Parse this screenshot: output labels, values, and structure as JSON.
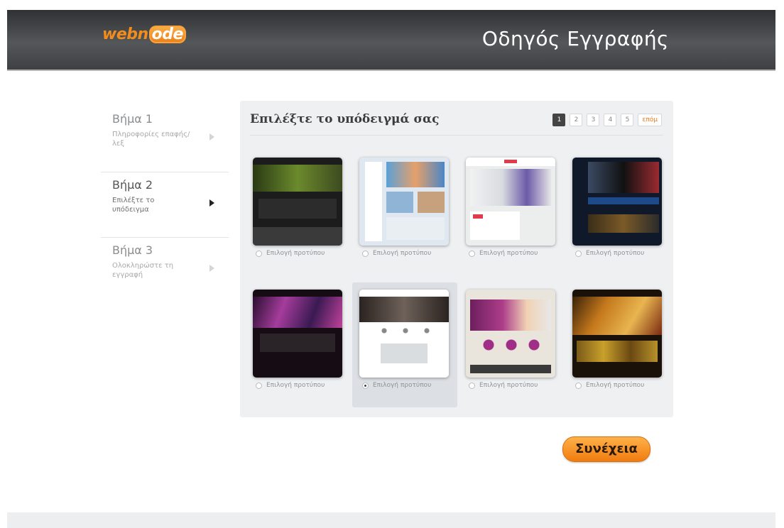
{
  "header": {
    "logo_text_pre": "webn",
    "logo_text_bubble": "ode",
    "title": "Οδηγός Εγγραφής"
  },
  "steps": [
    {
      "title": "Βήμα 1",
      "description": "Πληροφορίες επαφής/λεξ",
      "active": false
    },
    {
      "title": "Βήμα 2",
      "description": "Επιλέξτε το υπόδειγμα",
      "active": true
    },
    {
      "title": "Βήμα 3",
      "description": "Ολοκληρώστε τη εγγραφή",
      "active": false
    }
  ],
  "panel": {
    "title": "Επιλέξτε το υπόδειγμά σας",
    "pagination": {
      "pages": [
        "1",
        "2",
        "3",
        "4",
        "5"
      ],
      "current": "1",
      "next_label": "επόμ"
    }
  },
  "templates": [
    {
      "label": "Επιλογή προτύπου",
      "selected": false
    },
    {
      "label": "Επιλογή προτύπου",
      "selected": false
    },
    {
      "label": "Επιλογή προτύπου",
      "selected": false
    },
    {
      "label": "Επιλογή προτύπου",
      "selected": false
    },
    {
      "label": "Επιλογή προτύπου",
      "selected": false
    },
    {
      "label": "Επιλογή προτύπου",
      "selected": true
    },
    {
      "label": "Επιλογή προτύπου",
      "selected": false
    },
    {
      "label": "Επιλογή προτύπου",
      "selected": false
    }
  ],
  "actions": {
    "continue_label": "Συνέχεια"
  },
  "colors": {
    "accent": "#f07c10",
    "header": "#3e4042"
  }
}
